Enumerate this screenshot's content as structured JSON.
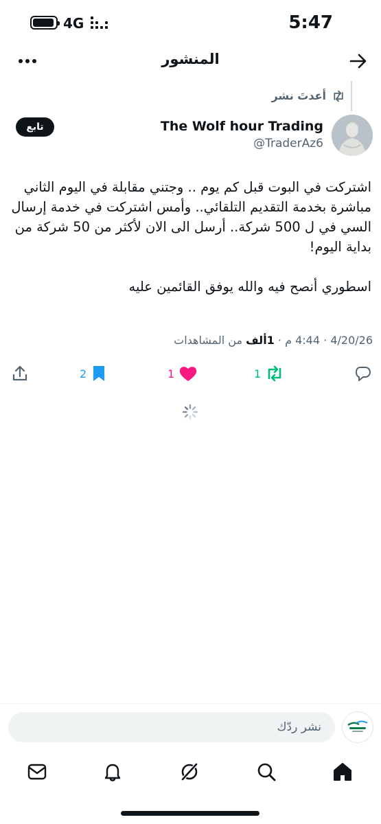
{
  "status_bar": {
    "time": "5:47",
    "network": "4G",
    "battery_icon": "battery-icon",
    "signal_icon": "signal-dots-icon"
  },
  "header": {
    "title": "المنشور",
    "back_icon": "arrow-right-icon",
    "more_icon": "more-horizontal-icon"
  },
  "repost": {
    "label": "أعدتَ نشر",
    "icon": "repost-icon"
  },
  "author": {
    "name": "The Wolf hour Trading",
    "handle": "@TraderAz6",
    "follow_label": "تابع"
  },
  "tweet": {
    "text": "اشتركت في البوت قبل كم يوم .. وجتني مقابلة في اليوم الثاني مباشرة بخدمة التقديم التلقائي.. وأمس اشتركت في خدمة إرسال السي في ل 500 شركة.. أرسل الى الان لأكثر من 50 شركة من بداية اليوم!\n\nاسطوري أنصح فيه والله يوفق القائمين عليه",
    "date": "4/20/26",
    "time": "4:44 م",
    "views_count": "1ألف",
    "views_label": "من المشاهدات",
    "separator": "·"
  },
  "actions": {
    "reply_icon": "reply-icon",
    "retweets": "1",
    "likes": "1",
    "bookmarks": "2",
    "share_icon": "share-icon"
  },
  "colors": {
    "text": "#0f1419",
    "secondary": "#536471",
    "retweet_green": "#00ba7c",
    "like_pink": "#f91880",
    "bookmark_blue": "#1d9bf0"
  },
  "reply_bar": {
    "placeholder": "نشر ردّك"
  },
  "tabs": [
    "home-icon",
    "search-icon",
    "grok-icon",
    "notifications-icon",
    "messages-icon"
  ]
}
